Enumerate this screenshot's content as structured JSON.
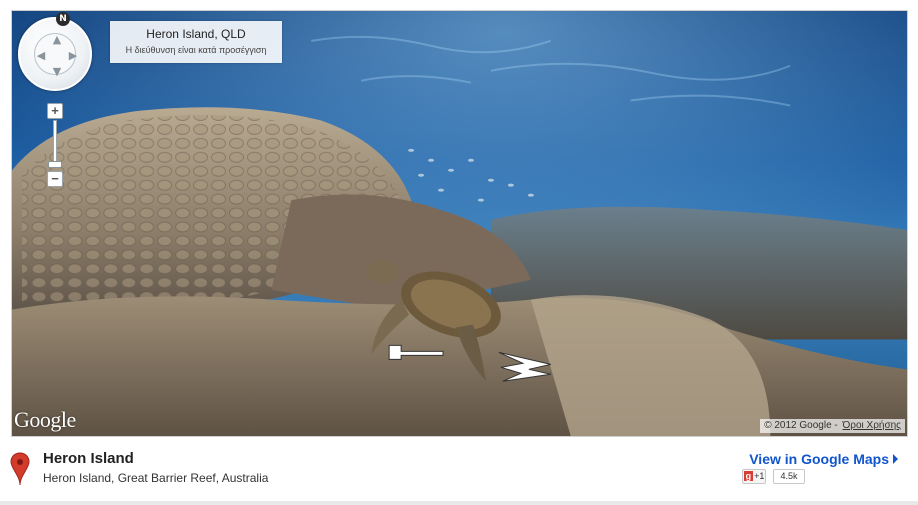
{
  "streetview": {
    "compass_north_label": "N",
    "address_title": "Heron Island, QLD",
    "address_note": "Η διεύθυνση είναι κατά προσέγγιση",
    "zoom_in_label": "+",
    "zoom_out_label": "−",
    "google_logo": "Google",
    "copyright": "© 2012 Google -",
    "terms_link": "Όροι Χρήσης"
  },
  "place": {
    "title": "Heron Island",
    "address": "Heron Island, Great Barrier Reef, Australia",
    "view_link": "View in Google Maps",
    "plusone_label": "+1",
    "plusone_count": "4.5k"
  },
  "colors": {
    "water_top": "#0b3d78",
    "water_mid": "#2a6fb0",
    "coral": "#9a8a74",
    "link": "#1155cc",
    "pin": "#d33b2c"
  },
  "icons": {
    "pin": "map-pin-icon",
    "nav_arrows": "street-arrow-icon"
  }
}
